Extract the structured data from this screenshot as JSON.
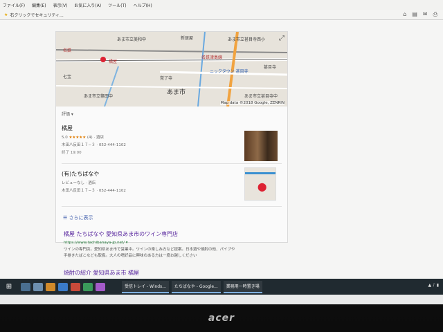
{
  "menubar": [
    "ファイル(F)",
    "編集(E)",
    "表示(V)",
    "お気に入り(A)",
    "ツール(T)",
    "ヘルプ(H)"
  ],
  "favbar": {
    "label": "右クリックでセキュリティ..."
  },
  "map": {
    "labels": [
      "あま市立美和中",
      "新居屋",
      "あま市立甚目寺西小",
      "名鉄津島線",
      "名鉄",
      "橘屋",
      "あま市",
      "ニックタウン 甚目寺",
      "あま市立篠田中",
      "あま市立甚目寺中",
      "覚了寺",
      "七宝",
      "甚目寺"
    ],
    "data_text": "Map data ©2018 Google, ZENRIN"
  },
  "rating_header": "評価 ▾",
  "businesses": [
    {
      "name": "橘屋",
      "rating": "5.0",
      "stars": "★★★★★",
      "count": "(4)",
      "category": "酒店",
      "address": "木田八反田１７−３ · 052-444-1102",
      "hours": "終了 19:00"
    },
    {
      "name": "(有)たちばなや",
      "rating_text": "レビューなし",
      "category": "酒店",
      "address": "木田八反田１７−３ · 052-444-1102"
    }
  ],
  "more_label": "さらに表示",
  "results": [
    {
      "title": "橘屋 たちばなや 愛知県あま市のワイン専門店",
      "url": "https://www.tachibanaya-jp.net/ ▾",
      "snippet": "ワインの専門店。愛知県あま市で営業中。ワインの楽しみ方など提案。日本酒や焼酎の他、パイプや 手巻きたばこなども取扱。大人の嗜好品に興味のある方は一度お越しください"
    },
    {
      "title": "焼酎の紹介 愛知県あま市 橘屋"
    }
  ],
  "taskbar": {
    "tasks": [
      "受信トレイ - Winds...",
      "たちばなや - Google...",
      "業務用一時置き場"
    ]
  },
  "brand": "acer"
}
